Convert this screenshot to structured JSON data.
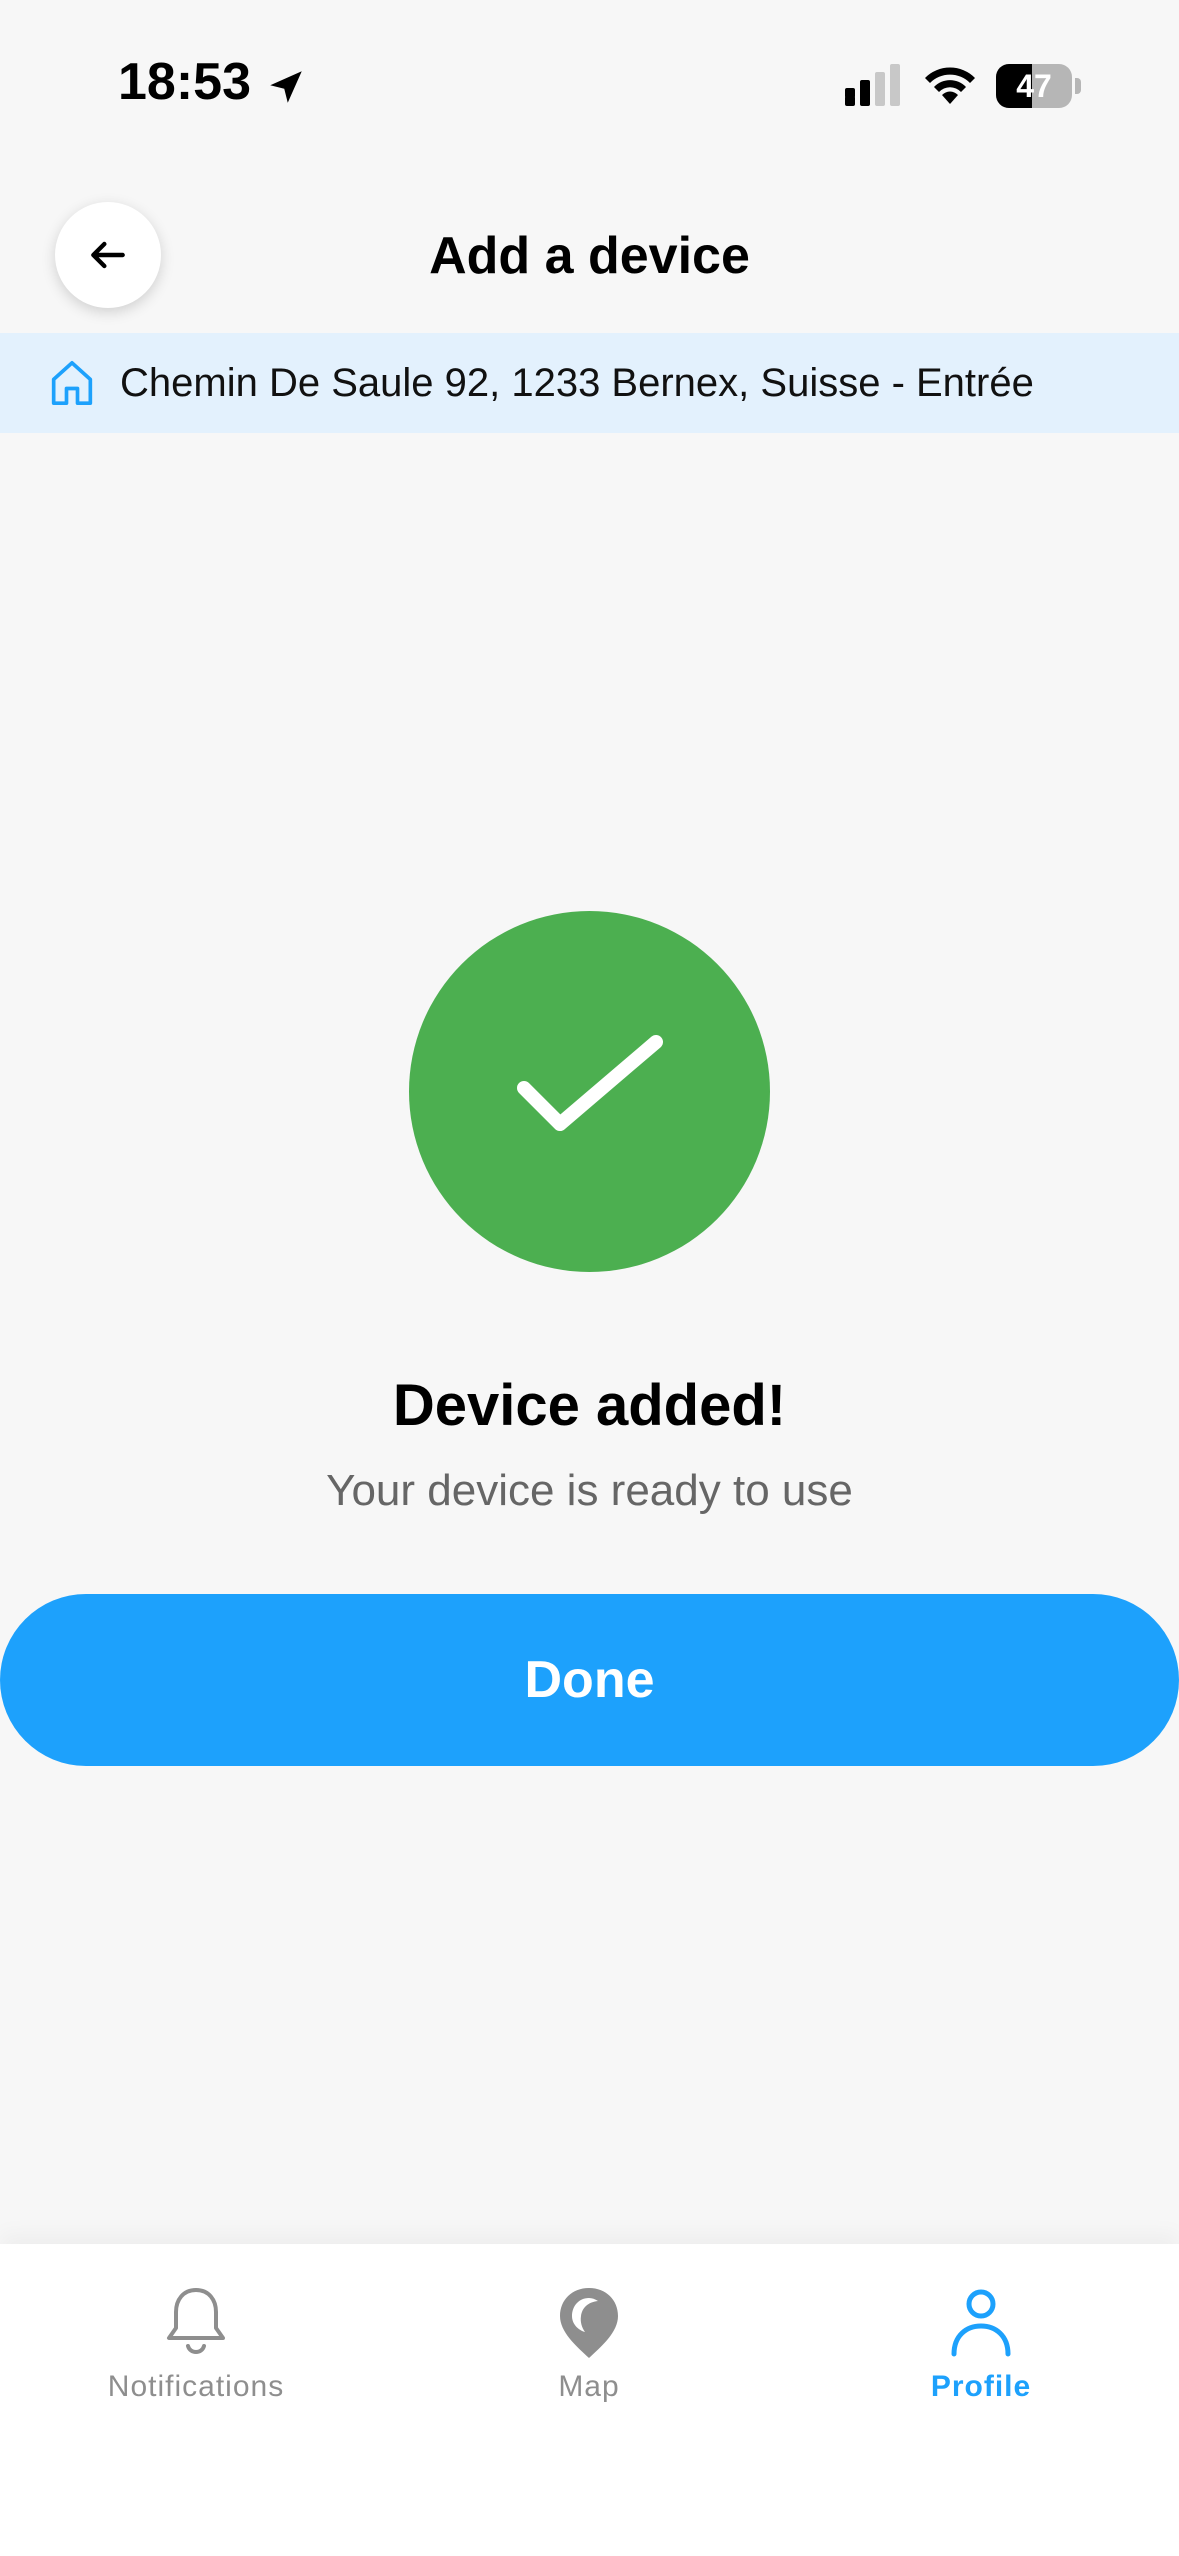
{
  "status_bar": {
    "time": "18:53",
    "battery_level": "47",
    "battery_fraction": 0.47
  },
  "header": {
    "title": "Add a device"
  },
  "address": {
    "text": "Chemin De Saule 92, 1233 Bernex, Suisse - Entrée"
  },
  "success": {
    "title": "Device added!",
    "subtitle": "Your device is ready to use"
  },
  "actions": {
    "done_label": "Done"
  },
  "tabs": [
    {
      "label": "Notifications",
      "icon": "bell-icon",
      "active": false
    },
    {
      "label": "Map",
      "icon": "map-pin-icon",
      "active": false
    },
    {
      "label": "Profile",
      "icon": "person-icon",
      "active": true
    }
  ],
  "colors": {
    "accent": "#1da1fc",
    "success": "#4caf50",
    "address_background": "#e3f1fd",
    "inactive_tab": "#8e8e8e"
  }
}
